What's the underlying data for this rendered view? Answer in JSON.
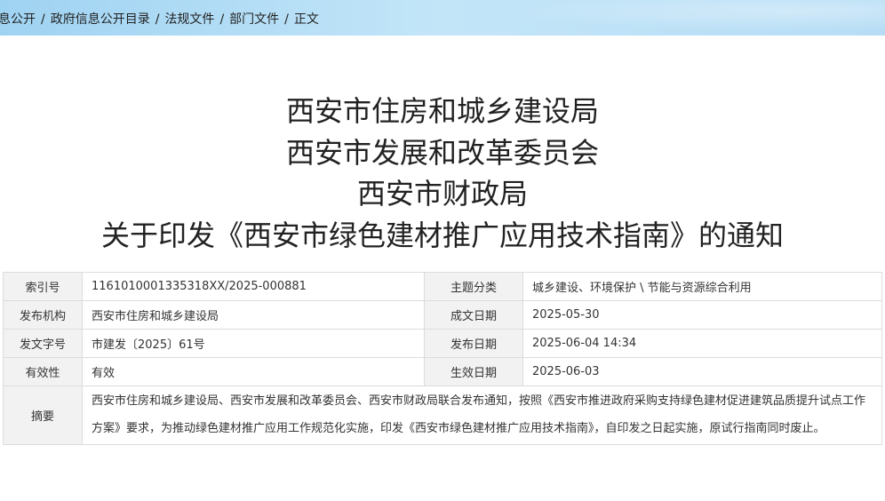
{
  "breadcrumb": {
    "items": [
      "息公开",
      "政府信息公开目录",
      "法规文件",
      "部门文件",
      "正文"
    ],
    "separator": "/"
  },
  "title": {
    "lines": [
      "西安市住房和城乡建设局",
      "西安市发展和改革委员会",
      "西安市财政局",
      "关于印发《西安市绿色建材推广应用技术指南》的通知"
    ]
  },
  "meta": {
    "index_label": "索引号",
    "index_value": "1161010001335318XX/2025-000881",
    "topic_label": "主题分类",
    "topic_value": "城乡建设、环境保护 \\ 节能与资源综合利用",
    "publisher_label": "发布机构",
    "publisher_value": "西安市住房和城乡建设局",
    "written_date_label": "成文日期",
    "written_date_value": "2025-05-30",
    "doc_no_label": "发文字号",
    "doc_no_value": "市建发〔2025〕61号",
    "publish_date_label": "发布日期",
    "publish_date_value": "2025-06-04 14:34",
    "validity_label": "有效性",
    "validity_value": "有效",
    "effective_date_label": "生效日期",
    "effective_date_value": "2025-06-03",
    "summary_label": "摘要",
    "summary_value": "西安市住房和城乡建设局、西安市发展和改革委员会、西安市财政局联合发布通知，按照《西安市推进政府采购支持绿色建材促进建筑品质提升试点工作方案》要求，为推动绿色建材推广应用工作规范化实施，印发《西安市绿色建材推广应用技术指南》，自印发之日起实施，原试行指南同时废止。"
  }
}
